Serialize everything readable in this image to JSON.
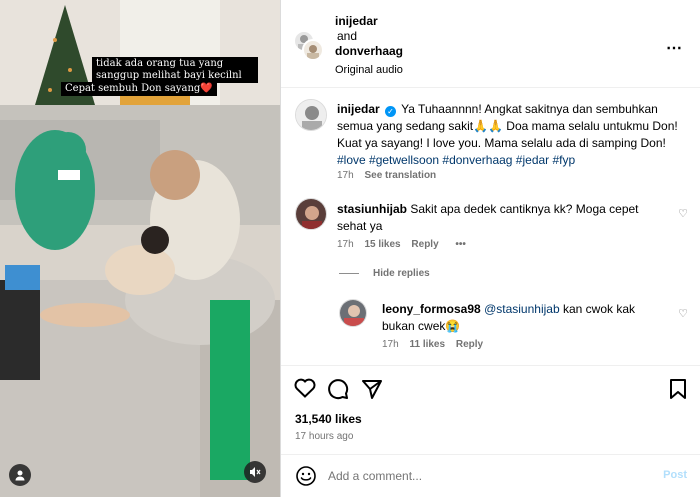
{
  "media": {
    "caption_line1": "tidak ada orang tua yang sanggup melihat bayi kecilnl",
    "caption_line2": "Cepat sembuh Don sayang❤️"
  },
  "header": {
    "user1": "inijedar",
    "and_text": "and",
    "user2": "donverhaag",
    "audio": "Original audio",
    "more_icon": "⋯"
  },
  "main_post": {
    "username": "inijedar",
    "text": "Ya Tuhaannnn! Angkat sakitnya dan sembuhkan semua yang sedang sakit🙏🙏 Doa mama selalu untukmu Don! Kuat ya sayang! I love you. Mama selalu ada di samping Don!",
    "hashtags": "#love #getwellsoon #donverhaag #jedar #fyp",
    "time": "17h",
    "see_translation": "See translation"
  },
  "comment1": {
    "username": "stasiunhijab",
    "text": "Sakit apa dedek cantiknya kk? Moga cepet sehat ya",
    "time": "17h",
    "likes": "15 likes",
    "reply": "Reply",
    "more": "•••"
  },
  "hide_replies": "Hide replies",
  "reply1": {
    "username": "leony_formosa98",
    "mention": "@stasiunhijab",
    "text": "kan cwok kak bukan cwek😭",
    "time": "17h",
    "likes": "11 likes",
    "reply": "Reply"
  },
  "likes_count": "31,540 likes",
  "posted_ago": "17 hours ago",
  "comment_box": {
    "placeholder": "Add a comment...",
    "post": "Post"
  },
  "colors": {
    "link": "#00376b",
    "verified": "#0095f6",
    "muted": "#737373"
  }
}
